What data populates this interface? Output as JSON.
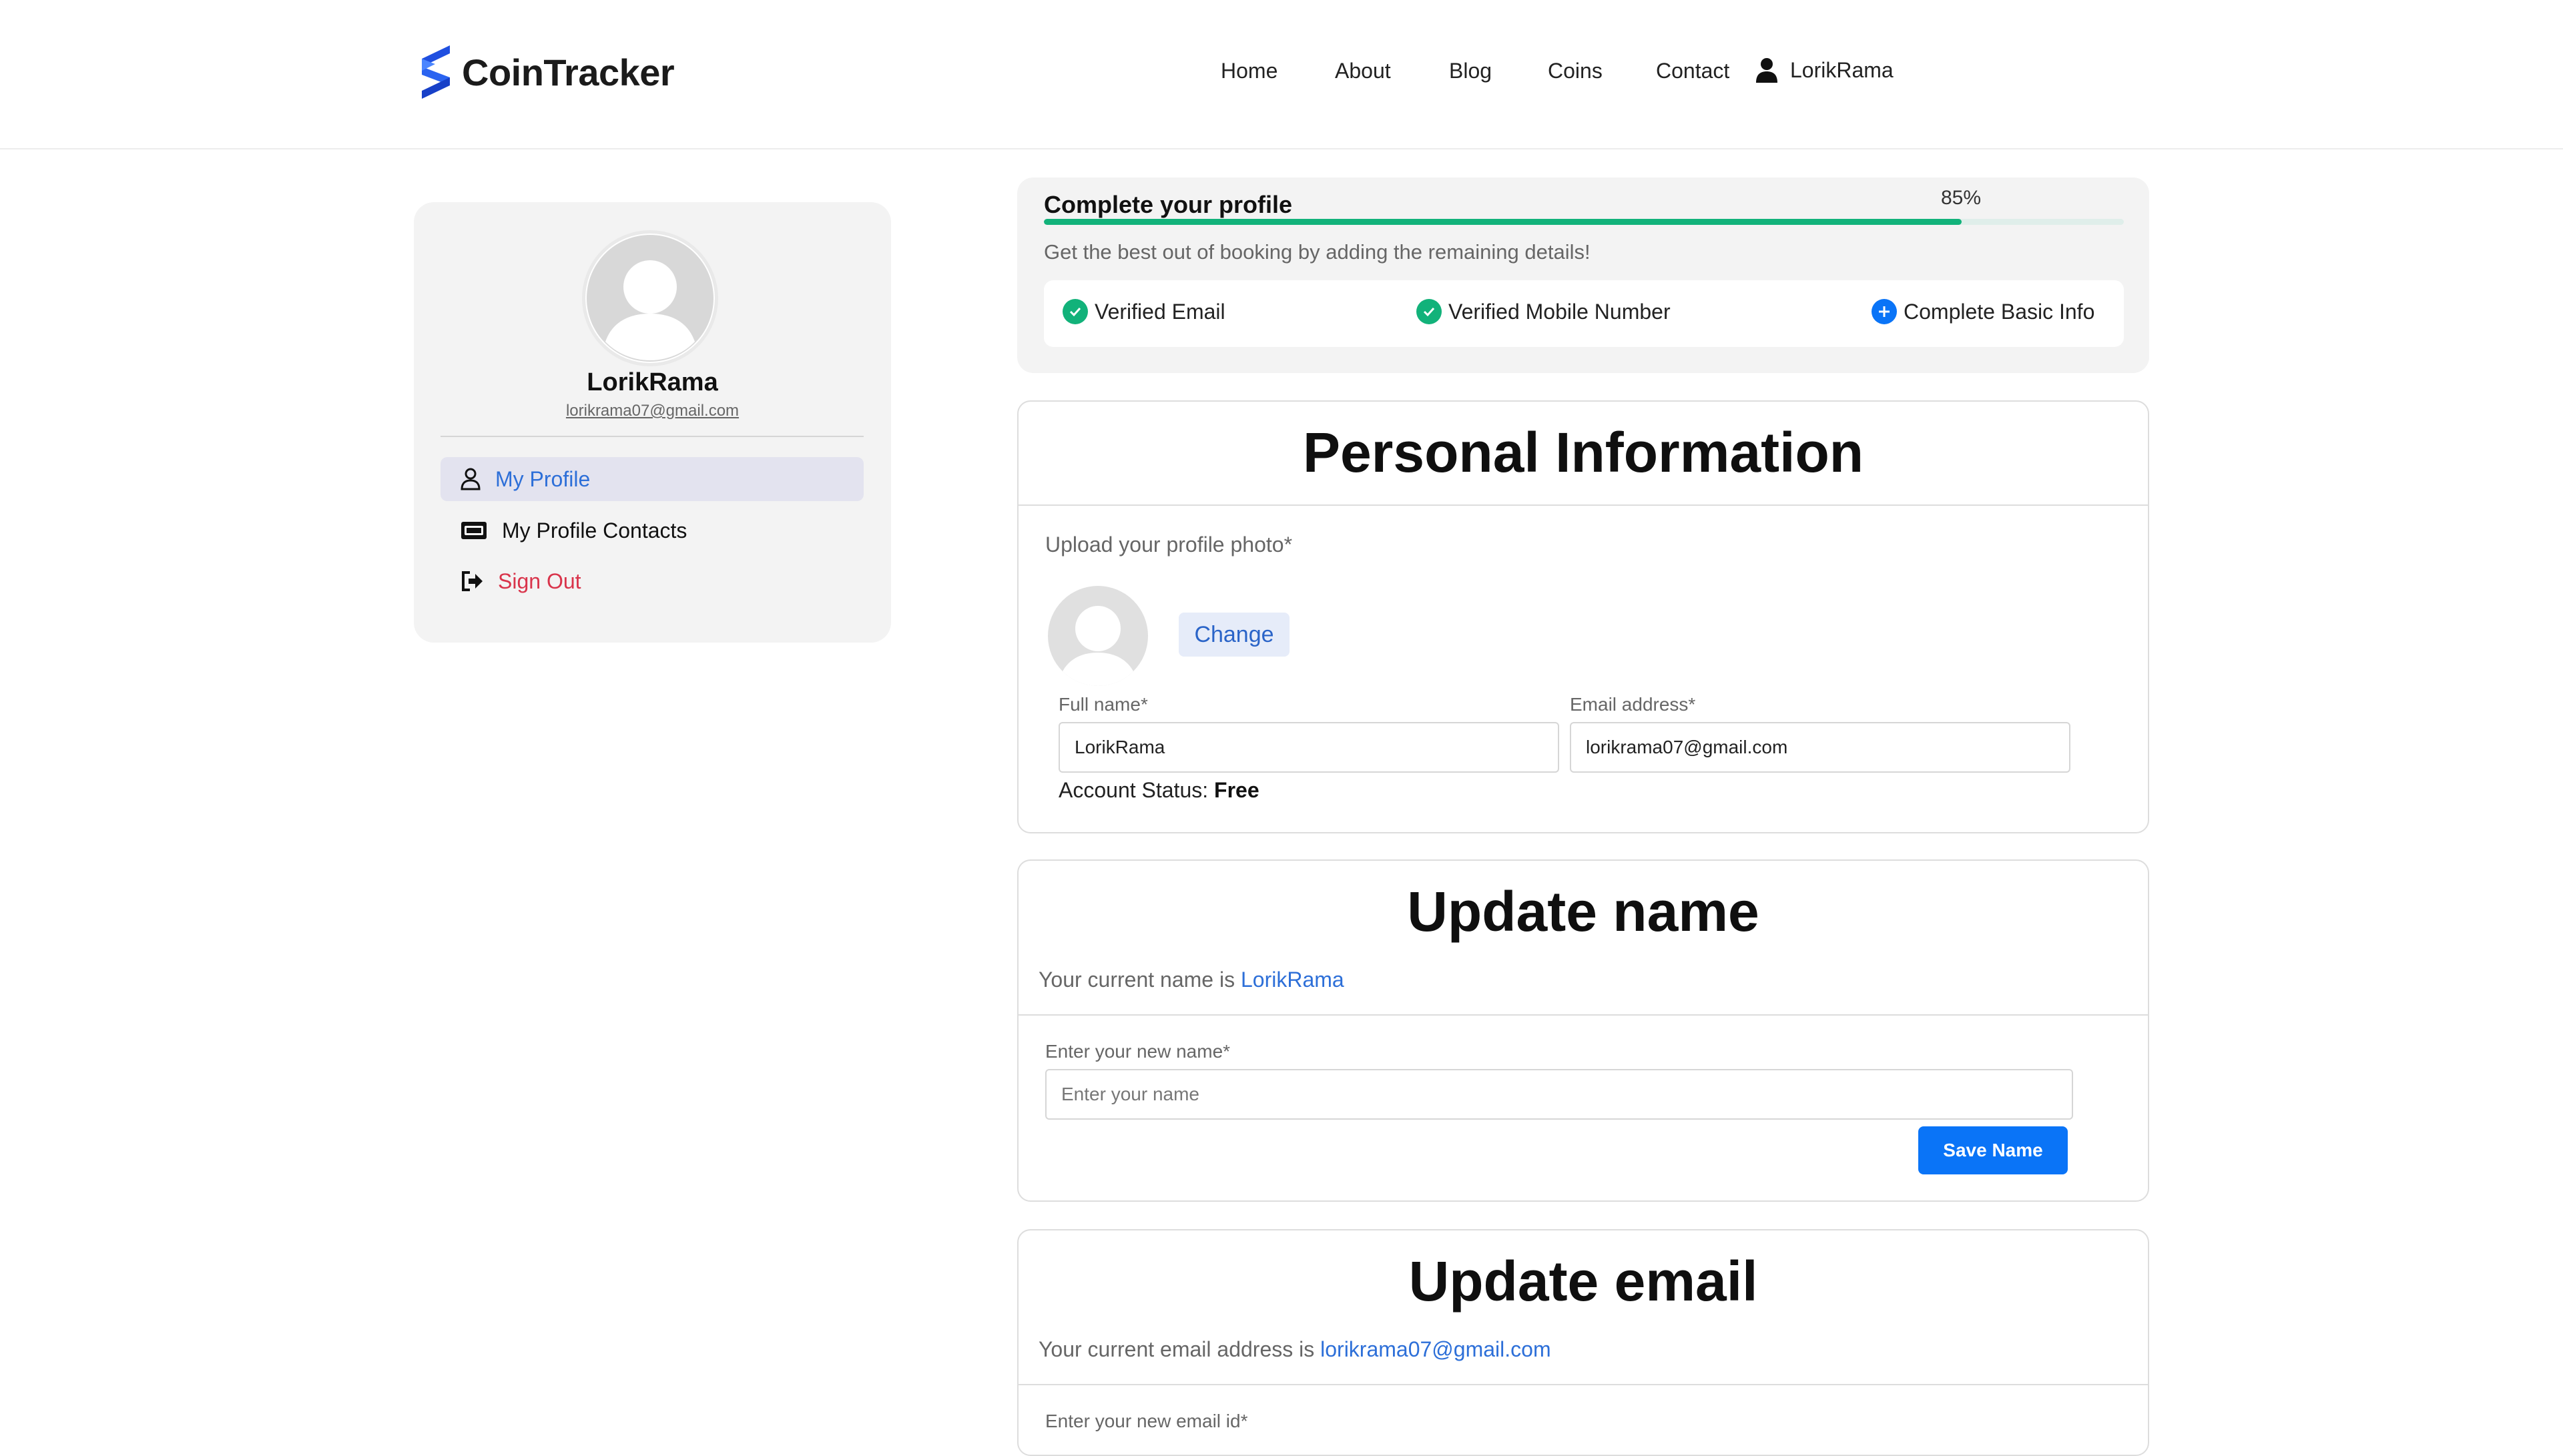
{
  "header": {
    "brand": "CoinTracker",
    "nav": [
      "Home",
      "About",
      "Blog",
      "Coins",
      "Contact"
    ],
    "user": "LorikRama"
  },
  "sidebar": {
    "name": "LorikRama",
    "email": "lorikrama07@gmail.com",
    "items": [
      {
        "label": "My Profile",
        "icon": "user-icon"
      },
      {
        "label": "My Profile Contacts",
        "icon": "contacts-icon"
      },
      {
        "label": "Sign Out",
        "icon": "sign-out-icon"
      }
    ]
  },
  "progress": {
    "title": "Complete your profile",
    "percent_label": "85%",
    "percent": 85,
    "subtitle": "Get the best out of booking by adding the remaining details!",
    "checks": [
      {
        "label": "Verified Email",
        "status": "done"
      },
      {
        "label": "Verified Mobile Number",
        "status": "done"
      },
      {
        "label": "Complete Basic Info",
        "status": "pending"
      }
    ]
  },
  "personal": {
    "title": "Personal Information",
    "upload_label": "Upload your profile photo*",
    "change_label": "Change",
    "fullname_label": "Full name*",
    "fullname_value": "LorikRama",
    "email_label": "Email address*",
    "email_value": "lorikrama07@gmail.com",
    "status_label": "Account Status:",
    "status_value": "Free"
  },
  "update_name": {
    "title": "Update name",
    "current_prefix": "Your current name is",
    "current_value": "LorikRama",
    "input_label": "Enter your new name*",
    "placeholder": "Enter your name",
    "save_label": "Save Name"
  },
  "update_email": {
    "title": "Update email",
    "current_prefix": "Your current email address is",
    "current_value": "lorikrama07@gmail.com",
    "input_label": "Enter your new email id*"
  },
  "colors": {
    "accent": "#0a74f7",
    "progress": "#12b27a",
    "link": "#2d6fd8",
    "danger": "#d9344b"
  }
}
